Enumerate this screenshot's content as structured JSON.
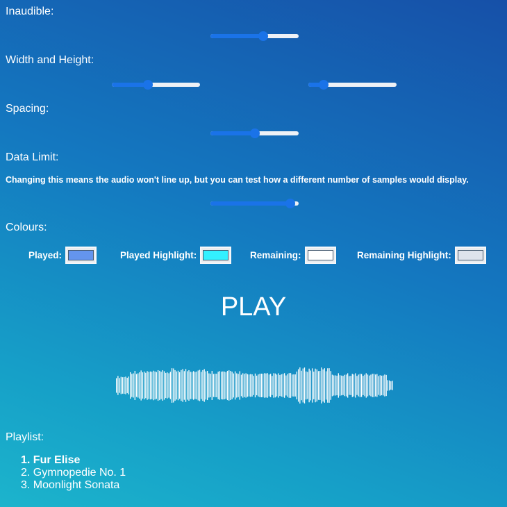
{
  "settings": {
    "inaudible": {
      "label": "Inaudible:",
      "value_percent": 61
    },
    "width_height": {
      "label": "Width and Height:",
      "width_percent": 40,
      "height_percent": 13
    },
    "spacing": {
      "label": "Spacing:",
      "value_percent": 50
    },
    "data_limit": {
      "label": "Data Limit:",
      "note": "Changing this means the audio won't line up, but you can test how a different number of samples would display.",
      "value_percent": 96
    }
  },
  "colours": {
    "label": "Colours:",
    "items": [
      {
        "label": "Played:",
        "color": "#6495ed"
      },
      {
        "label": "Played Highlight:",
        "color": "#33f0ff"
      },
      {
        "label": "Remaining:",
        "color": "#ffffff"
      },
      {
        "label": "Remaining Highlight:",
        "color": "#dde3ec"
      }
    ]
  },
  "player": {
    "play_label": "PLAY",
    "waveform_color": "#ffffff"
  },
  "playlist": {
    "label": "Playlist:",
    "tracks": [
      {
        "number": "1.",
        "title": "Fur Elise",
        "active": true
      },
      {
        "number": "2.",
        "title": "Gymnopedie No. 1",
        "active": false
      },
      {
        "number": "3.",
        "title": "Moonlight Sonata",
        "active": false
      }
    ]
  }
}
